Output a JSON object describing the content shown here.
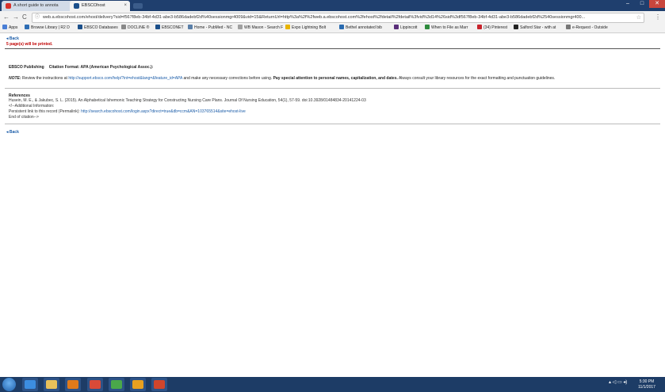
{
  "tabs": [
    {
      "title": "A short guide to annota",
      "close": "×"
    },
    {
      "title": "EBSCOhost",
      "close": "×"
    }
  ],
  "window": {
    "min": "–",
    "max": "□",
    "close": "✕"
  },
  "toolbar": {
    "back": "←",
    "forward": "→",
    "reload": "C",
    "url": "web.a.ebscohost.com/ehost/delivery?sid=f567f8eb-34bf-4d31-abe3-b586dadebf2d%40sessionmgr4009&vid=15&ReturnUrl=http%3a%2f%2fweb.a.ebscohost.com%2fehost%2fdetail%2fdetail%3fvid%3d14%26sid%3df567f8eb-34bf-4d31-abe3-b586dadebf2d%2540sessionmgr400...",
    "info_icon": "ⓘ",
    "star": "☆",
    "menu": "⋮"
  },
  "bookmarks": [
    {
      "label": "Apps",
      "color": "#4a7fd6"
    },
    {
      "label": "Browse Library | R2 D",
      "color": "#2e6db4"
    },
    {
      "label": "EBSCO Databases",
      "color": "#1b4f8a"
    },
    {
      "label": "DOCLINE ®",
      "color": "#888888"
    },
    {
      "label": "EBSCONET",
      "color": "#1b4f8a"
    },
    {
      "label": "Home - PubMed - NC",
      "color": "#5a7fa8"
    },
    {
      "label": "WB Mason - Search F",
      "color": "#a0a0a0"
    },
    {
      "label": "Expo Lightning Bolt",
      "color": "#e8b400"
    },
    {
      "label": "Bethel annotated bib",
      "color": "#2a6bb0"
    },
    {
      "label": "Lippincott",
      "color": "#5a2e7a"
    },
    {
      "label": "When to File as Marr",
      "color": "#2e8b3d"
    },
    {
      "label": "(34) Pinterest",
      "color": "#c8232c"
    },
    {
      "label": "Salford Star - with at",
      "color": "#222222"
    },
    {
      "label": "e-Request - Outside",
      "color": "#777777"
    }
  ],
  "page": {
    "back_link": "◂ Back",
    "printed_notice": "5 page(s) will be printed.",
    "publisher": "EBSCO Publishing",
    "citation_format": "Citation Format: APA (American Psychological Assoc.):",
    "note_label": "NOTE:",
    "note_text_1": " Review the instructions at ",
    "note_link": "http://support.ebsco.com/help/?int=ehost&lang=&feature_id=APA",
    "note_text_2": " and make any necessary corrections before using. ",
    "note_bold": "Pay special attention to personal names, capitalization, and dates.",
    "note_text_3": " Always consult your library resources for the exact formatting and punctuation guidelines.",
    "references_heading": "References",
    "ref_citation": "Husein, M. E., & Jakubec, S. L. (2015). An Alphabetical Ishemonic Teaching Strategy for Constructing Nursing Care Plans. Journal Of Nursing Education, 54(1), 57-59. doi:10.3928/01484834-20141224-03",
    "ref_additional": "<!--Additional Information:",
    "ref_permalink_label": "Persistent link to this record (Permalink): ",
    "ref_permalink": "http://search.ebscohost.com/login.aspx?direct=true&db=ccm&AN=103765514&site=ehost-live",
    "ref_end": "End of citation-->",
    "back_link_bottom": "◂ Back"
  },
  "taskbar": {
    "apps": [
      {
        "name": "internet-explorer",
        "color": "#3c8de0"
      },
      {
        "name": "file-explorer",
        "color": "#e8c15a"
      },
      {
        "name": "media-player",
        "color": "#e07a1a"
      },
      {
        "name": "chrome",
        "color": "#d84a38"
      },
      {
        "name": "app-green",
        "color": "#4aa84a"
      },
      {
        "name": "outlook",
        "color": "#e8a020"
      },
      {
        "name": "powerpoint",
        "color": "#d0452c"
      }
    ],
    "tray_icons": "▴ ◁ ▭ ◂)",
    "time": "5:30 PM",
    "date": "11/1/2017"
  }
}
